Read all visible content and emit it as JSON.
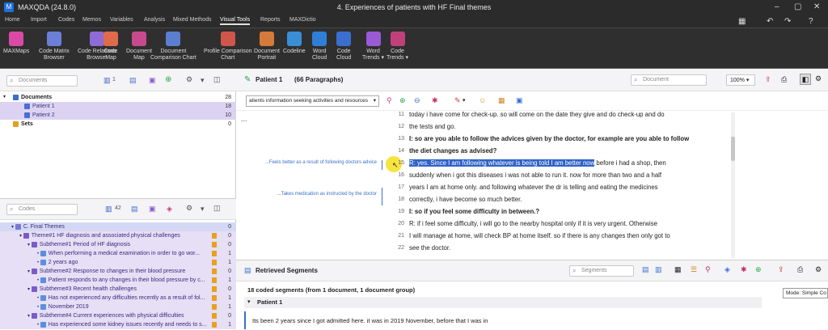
{
  "titlebar": {
    "app_name": "MAXQDA (24.8.0)",
    "document_title": "4. Experiences of patients with HF Final themes",
    "logo_letter": "M"
  },
  "menu": {
    "items": [
      "Home",
      "Import",
      "Codes",
      "Memos",
      "Variables",
      "Analysis",
      "Mixed Methods",
      "Visual Tools",
      "Reports",
      "MAXDictio"
    ],
    "active": "Visual Tools"
  },
  "ribbon": {
    "buttons": [
      {
        "label1": "MAXMaps",
        "label2": "",
        "color": "#d94aa6"
      },
      {
        "label1": "Code Matrix",
        "label2": "Browser",
        "color": "#6b7fd6"
      },
      {
        "label1": "Code Relations",
        "label2": "Browser",
        "color": "#8e6bd6"
      },
      {
        "label1": "Code",
        "label2": "Map",
        "color": "#e06b4a"
      },
      {
        "label1": "Document",
        "label2": "Map",
        "color": "#c84a8e"
      },
      {
        "label1": "Document",
        "label2": "Comparison Chart",
        "color": "#5a7fd0"
      },
      {
        "label1": "Profile Comparison",
        "label2": "Chart",
        "color": "#d0554a"
      },
      {
        "label1": "Document",
        "label2": "Portrait",
        "color": "#d67a3a"
      },
      {
        "label1": "Codeline",
        "label2": "",
        "color": "#3a8ed6"
      },
      {
        "label1": "Word",
        "label2": "Cloud",
        "color": "#2f7fd8"
      },
      {
        "label1": "Code",
        "label2": "Cloud",
        "color": "#3a6fd0"
      },
      {
        "label1": "Word",
        "label2": "Trends ▾",
        "color": "#9a5ad6"
      },
      {
        "label1": "Code",
        "label2": "Trends ▾",
        "color": "#c0407a"
      }
    ]
  },
  "documents_pane": {
    "search_placeholder": "Documents",
    "toolbar_count": "1",
    "tree": [
      {
        "label": "Documents",
        "count": "28"
      },
      {
        "label": "Patient 1",
        "count": "18"
      },
      {
        "label": "Patient 2",
        "count": "10"
      },
      {
        "label": "Sets",
        "count": "0"
      }
    ]
  },
  "codes_pane": {
    "search_placeholder": "Codes",
    "toolbar_count": "42",
    "tree": [
      {
        "label": "C. Final Themes",
        "count": "0"
      },
      {
        "label": "Theme#1 HF diagnosis and associated physical challenges",
        "count": "0"
      },
      {
        "label": "Subtheme#1 Period of HF diagnosis",
        "count": "0"
      },
      {
        "label": "When performing a medical examination in order to go wor...",
        "count": "1"
      },
      {
        "label": "2 years ago",
        "count": "1"
      },
      {
        "label": "Subtheme#2 Response to changes in their blood pressure",
        "count": "0"
      },
      {
        "label": "Patient responds to any changes in their blood pressure by c...",
        "count": "1"
      },
      {
        "label": "Subtheme#3 Recent health challenges",
        "count": "0"
      },
      {
        "label": "Has not experienced any difficulties recently as a result of fol...",
        "count": "1"
      },
      {
        "label": "November 2019",
        "count": "1"
      },
      {
        "label": "Subtheme#4 Current experiences with physical difficulties",
        "count": "0"
      },
      {
        "label": "Has experienced some kidney issues recently and needs to s...",
        "count": "1"
      }
    ]
  },
  "document_browser": {
    "title": "Patient 1",
    "paragraphs": "(66 Paragraphs)",
    "search_placeholder": "Document",
    "zoom": "100%",
    "code_dropdown": "atients information seeking activities and resources",
    "more": "...",
    "lines": [
      {
        "num": "11",
        "text": "today i have come for check-up. so will come on the date they give and do check-up and do",
        "bold": false
      },
      {
        "num": "12",
        "text": "the tests and go.",
        "bold": false
      },
      {
        "num": "13",
        "text": "I: so are you able to follow the advices given by the doctor, for example are you able to follow",
        "bold": true
      },
      {
        "num": "14",
        "text": "the diet changes as advised?",
        "bold": true
      },
      {
        "num": "15",
        "text": "R: yes. Since I am following whatever is being told I am better now",
        "tail": " before i had a shop, then",
        "bold": false
      },
      {
        "num": "16",
        "text": "suddenly when i got this diseases i was not able to run it. now for more than two and a half",
        "bold": false
      },
      {
        "num": "17",
        "text": "years I am at home only. and following whatever the dr is telling and eating the medicines",
        "bold": false
      },
      {
        "num": "18",
        "text": "correctly, i have become so much better.",
        "bold": false
      },
      {
        "num": "19",
        "text": "I: so if you feel some difficulty in between.?",
        "bold": true
      },
      {
        "num": "20",
        "text": "R: if i feel some difficulty, i will go to the nearby hospital only if it is very urgent. Otherwise",
        "bold": false
      },
      {
        "num": "21",
        "text": "I will manage at home, will check BP at home itself. so if there is any changes then only got to",
        "bold": false
      },
      {
        "num": "22",
        "text": "see the doctor.",
        "bold": false
      }
    ],
    "memos": [
      "...Feels better as a result of following doctors advice",
      "...Takes medication as instructed by the doctor"
    ]
  },
  "retrieved_segments": {
    "title": "Retrieved Segments",
    "search_placeholder": "Segments",
    "summary": "18 coded segments (from 1 document, 1 document group)",
    "group_label": "Patient 1",
    "segment_text": "Its been 2 years since I got admitted here. it was in 2019 November, before that I was in",
    "tooltip": "Mode: Simple Co"
  },
  "colors": {
    "accent": "#2f62c8",
    "selection": "#dcd3f2",
    "code_purple": "#7a5cc7"
  }
}
